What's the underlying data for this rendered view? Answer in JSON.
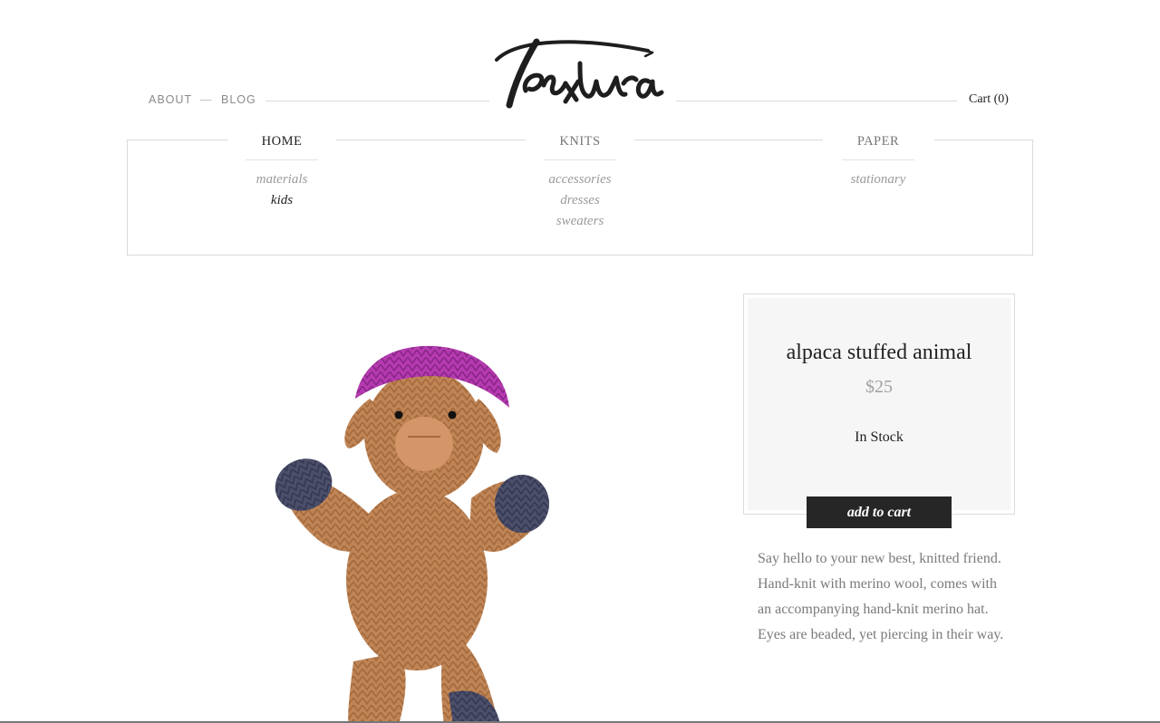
{
  "header": {
    "nav_left": [
      {
        "label": "ABOUT"
      },
      {
        "label": "BLOG"
      }
    ],
    "separator": "—",
    "logo_text": "textura",
    "cart_label": "Cart (0)"
  },
  "nav": [
    {
      "label": "HOME",
      "active": true,
      "items": [
        {
          "label": "materials",
          "active": false
        },
        {
          "label": "kids",
          "active": true
        }
      ]
    },
    {
      "label": "KNITS",
      "active": false,
      "items": [
        {
          "label": "accessories",
          "active": false
        },
        {
          "label": "dresses",
          "active": false
        },
        {
          "label": "sweaters",
          "active": false
        }
      ]
    },
    {
      "label": "PAPER",
      "active": false,
      "items": [
        {
          "label": "stationary",
          "active": false
        }
      ]
    }
  ],
  "product": {
    "title": "alpaca stuffed animal",
    "price": "$25",
    "stock": "In Stock",
    "add_to_cart_label": "add to cart",
    "description": "Say hello to your new best, knitted friend. Hand-knit with merino wool, comes with an accompanying hand-knit merino hat. Eyes are beaded, yet piercing in their way."
  },
  "colors": {
    "text": "#222222",
    "muted": "#9a9a9a",
    "button": "#262626",
    "panel": "#f6f6f6",
    "rule": "#d9d9d9"
  }
}
